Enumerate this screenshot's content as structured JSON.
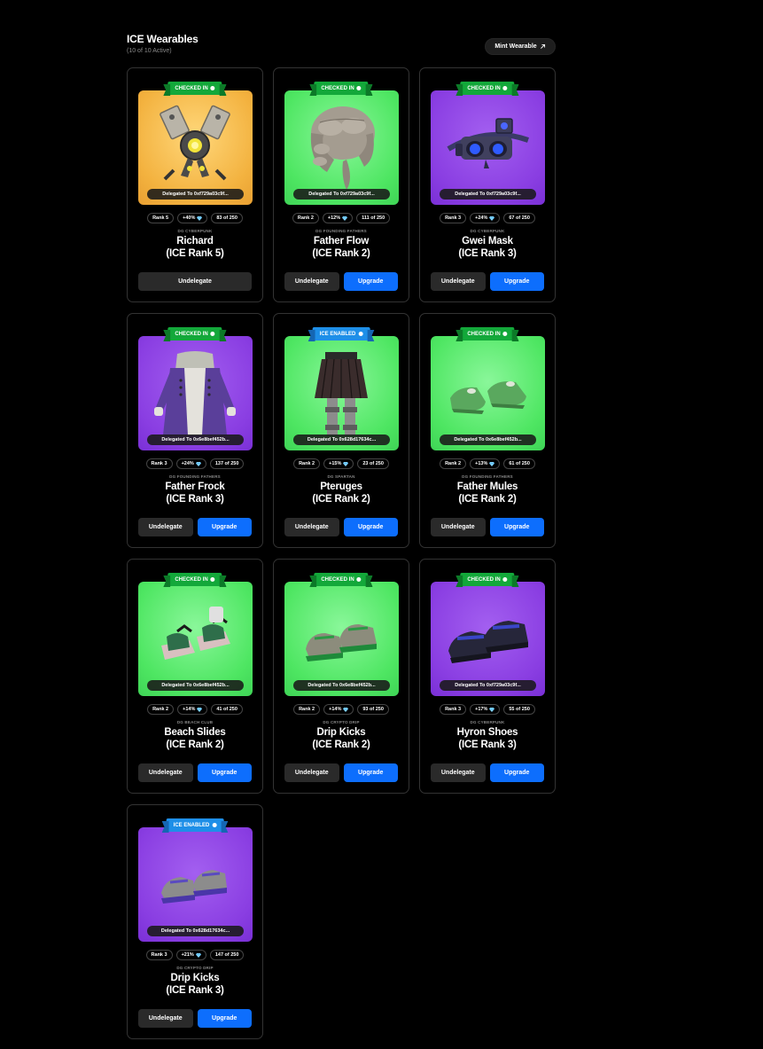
{
  "header": {
    "title": "ICE Wearables",
    "subtitle": "(10 of 10 Active)",
    "mint_label": "Mint Wearable"
  },
  "colors": {
    "checked_ribbon": "#13a83a",
    "ice_ribbon": "#1e8fe8",
    "upgrade_button": "#0d6efd",
    "undelegate_button": "#2a2a2a"
  },
  "cards": [
    {
      "status": "CHECKED IN",
      "status_type": "checked",
      "bg": "yellow",
      "art": "drone",
      "delegated": "Delegated To 0xf729a03c9f...",
      "rank": "Rank 5",
      "bonus": "+40%",
      "count": "83 of 250",
      "collection": "DG CYBERPUNK",
      "name_line1": "Richard",
      "name_line2": "(ICE Rank 5)",
      "undelegate": "Undelegate",
      "upgrade": ""
    },
    {
      "status": "CHECKED IN",
      "status_type": "checked",
      "bg": "green",
      "art": "wig",
      "delegated": "Delegated To 0xf729a03c9f...",
      "rank": "Rank 2",
      "bonus": "+12%",
      "count": "111 of 250",
      "collection": "DG FOUNDING FATHERS",
      "name_line1": "Father Flow",
      "name_line2": "(ICE Rank 2)",
      "undelegate": "Undelegate",
      "upgrade": "Upgrade"
    },
    {
      "status": "CHECKED IN",
      "status_type": "checked",
      "bg": "purple",
      "art": "mask",
      "delegated": "Delegated To 0xf729a03c9f...",
      "rank": "Rank 3",
      "bonus": "+24%",
      "count": "67 of 250",
      "collection": "DG CYBERPUNK",
      "name_line1": "Gwei Mask",
      "name_line2": "(ICE Rank 3)",
      "undelegate": "Undelegate",
      "upgrade": "Upgrade"
    },
    {
      "status": "CHECKED IN",
      "status_type": "checked",
      "bg": "purple",
      "art": "frock",
      "delegated": "Delegated To 0x6e8bef452b...",
      "rank": "Rank 3",
      "bonus": "+24%",
      "count": "137 of 250",
      "collection": "DG FOUNDING FATHERS",
      "name_line1": "Father Frock",
      "name_line2": "(ICE Rank 3)",
      "undelegate": "Undelegate",
      "upgrade": "Upgrade"
    },
    {
      "status": "ICE ENABLED",
      "status_type": "ice",
      "bg": "green",
      "art": "skirt",
      "delegated": "Delegated To 0x628d17634c...",
      "rank": "Rank 2",
      "bonus": "+15%",
      "count": "23 of 250",
      "collection": "DG SPARTAN",
      "name_line1": "Pteruges",
      "name_line2": "(ICE Rank 2)",
      "undelegate": "Undelegate",
      "upgrade": "Upgrade"
    },
    {
      "status": "CHECKED IN",
      "status_type": "checked",
      "bg": "green",
      "art": "mules",
      "delegated": "Delegated To 0x6e8bef452b...",
      "rank": "Rank 2",
      "bonus": "+13%",
      "count": "61 of 250",
      "collection": "DG FOUNDING FATHERS",
      "name_line1": "Father Mules",
      "name_line2": "(ICE Rank 2)",
      "undelegate": "Undelegate",
      "upgrade": "Upgrade"
    },
    {
      "status": "CHECKED IN",
      "status_type": "checked",
      "bg": "green",
      "art": "slides",
      "delegated": "Delegated To 0x6e8bef452b...",
      "rank": "Rank 2",
      "bonus": "+14%",
      "count": "41 of 250",
      "collection": "DG BEACH CLUB",
      "name_line1": "Beach Slides",
      "name_line2": "(ICE Rank 2)",
      "undelegate": "Undelegate",
      "upgrade": "Upgrade"
    },
    {
      "status": "CHECKED IN",
      "status_type": "checked",
      "bg": "green",
      "art": "kicks-green",
      "delegated": "Delegated To 0x6e8bef452b...",
      "rank": "Rank 2",
      "bonus": "+14%",
      "count": "93 of 250",
      "collection": "DG CRYPTO DRIP",
      "name_line1": "Drip Kicks",
      "name_line2": "(ICE Rank 2)",
      "undelegate": "Undelegate",
      "upgrade": "Upgrade"
    },
    {
      "status": "CHECKED IN",
      "status_type": "checked",
      "bg": "purple",
      "art": "hyron",
      "delegated": "Delegated To 0xf729a03c9f...",
      "rank": "Rank 3",
      "bonus": "+17%",
      "count": "55 of 250",
      "collection": "DG CYBERPUNK",
      "name_line1": "Hyron Shoes",
      "name_line2": "(ICE Rank 3)",
      "undelegate": "Undelegate",
      "upgrade": "Upgrade"
    },
    {
      "status": "ICE ENABLED",
      "status_type": "ice",
      "bg": "purple",
      "art": "kicks-purple",
      "delegated": "Delegated To 0x628d17634c...",
      "rank": "Rank 3",
      "bonus": "+21%",
      "count": "147 of 250",
      "collection": "DG CRYPTO DRIP",
      "name_line1": "Drip Kicks",
      "name_line2": "(ICE Rank 3)",
      "undelegate": "Undelegate",
      "upgrade": "Upgrade"
    }
  ]
}
